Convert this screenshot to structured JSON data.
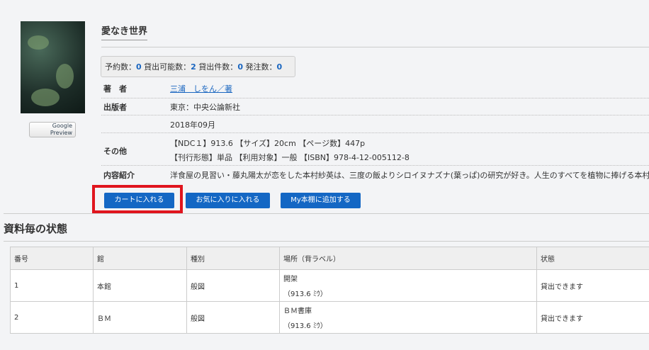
{
  "book": {
    "title": "愛なき世界",
    "google_preview": "Google Preview"
  },
  "counts": {
    "reserve_label": "予約数：",
    "reserve": "0",
    "available_label": "貸出可能数：",
    "available": "2",
    "loans_label": "貸出件数：",
    "loans": "0",
    "orders_label": "発注数：",
    "orders": "0"
  },
  "details": [
    {
      "label": "著　者",
      "value": "三浦　しをん／著"
    },
    {
      "label": "出版者",
      "value": "東京：中央公論新社"
    },
    {
      "label": "",
      "value": "2018年09月"
    },
    {
      "label": "その他",
      "value": "【NDC１】913.6 【サイズ】20cm 【ページ数】447p",
      "value2": "【刊行形態】単品 【利用対象】一般 【ISBN】978-4-12-005112-8"
    },
    {
      "label": "内容紹介",
      "value": "洋食屋の見習い・藤丸陽太が恋をした本村紗英は、三度の飯よりシロイヌナズナ(葉っぱ)の研究が好き。人生のすべてを植物に捧げる本村に"
    }
  ],
  "buttons": {
    "cart": "カートに入れる",
    "favorite": "お気に入りに入れる",
    "shelf": "My本棚に追加する"
  },
  "section_title": "資料毎の状態",
  "table": {
    "headers": [
      "番号",
      "館",
      "種別",
      "場所（背ラベル）",
      "状態"
    ],
    "rows": [
      [
        "1",
        "本館",
        "般図",
        "開架",
        "（913.6 ﾐｳ）",
        "貸出できます"
      ],
      [
        "2",
        "ＢＭ",
        "般図",
        "ＢＭ書庫",
        "（913.6 ﾐｳ）",
        "貸出できます"
      ]
    ]
  }
}
